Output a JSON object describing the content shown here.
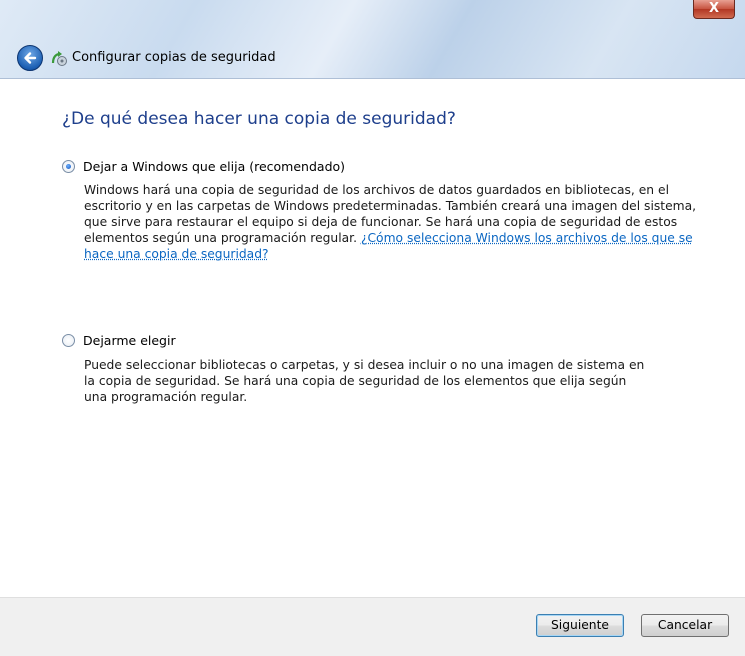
{
  "window": {
    "title": "Configurar copias de seguridad",
    "close_label": "X"
  },
  "main": {
    "heading": "¿De qué desea hacer una copia de seguridad?",
    "options": [
      {
        "label": "Dejar a Windows que elija (recomendado)",
        "selected": true,
        "description": [
          "Windows hará una copia de seguridad de los archivos de datos guardados en bibliotecas, en el",
          "escritorio y en las carpetas de Windows predeterminadas. También creará una imagen del sistema,",
          "que sirve para restaurar el equipo si deja de funcionar. Se hará una copia de seguridad de estos",
          "elementos según una programación regular. "
        ],
        "link_part1": "¿Cómo selecciona Windows los archivos de los que se",
        "link_part2": "hace una copia de seguridad?"
      },
      {
        "label": "Dejarme elegir",
        "selected": false,
        "description": [
          "Puede seleccionar bibliotecas o carpetas, y si desea incluir o no una imagen de sistema en",
          "la copia de seguridad. Se hará una copia de seguridad de los elementos que elija según",
          "una programación regular."
        ]
      }
    ]
  },
  "footer": {
    "next_label": "Siguiente",
    "cancel_label": "Cancelar"
  }
}
